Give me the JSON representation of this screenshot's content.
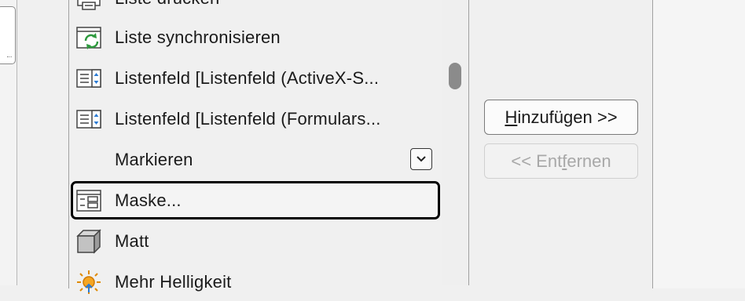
{
  "commands": [
    {
      "label": "Liste drucken",
      "icon": "print-list-icon"
    },
    {
      "label": "Liste synchronisieren",
      "icon": "sync-list-icon"
    },
    {
      "label": "Listenfeld [Listenfeld (ActiveX-S...",
      "icon": "listbox-icon"
    },
    {
      "label": "Listenfeld [Listenfeld (Formulars...",
      "icon": "listbox-icon"
    },
    {
      "label": "Markieren",
      "icon": "",
      "has_dropdown": true
    },
    {
      "label": "Maske...",
      "icon": "form-icon",
      "selected": true
    },
    {
      "label": "Matt",
      "icon": "cube-icon"
    },
    {
      "label": "Mehr Helligkeit",
      "icon": "brightness-icon"
    }
  ],
  "buttons": {
    "add": {
      "accel": "H",
      "rest": "inzufügen >>"
    },
    "remove": {
      "pre": "<< Ent",
      "accel": "f",
      "rest": "ernen",
      "disabled": true
    }
  }
}
